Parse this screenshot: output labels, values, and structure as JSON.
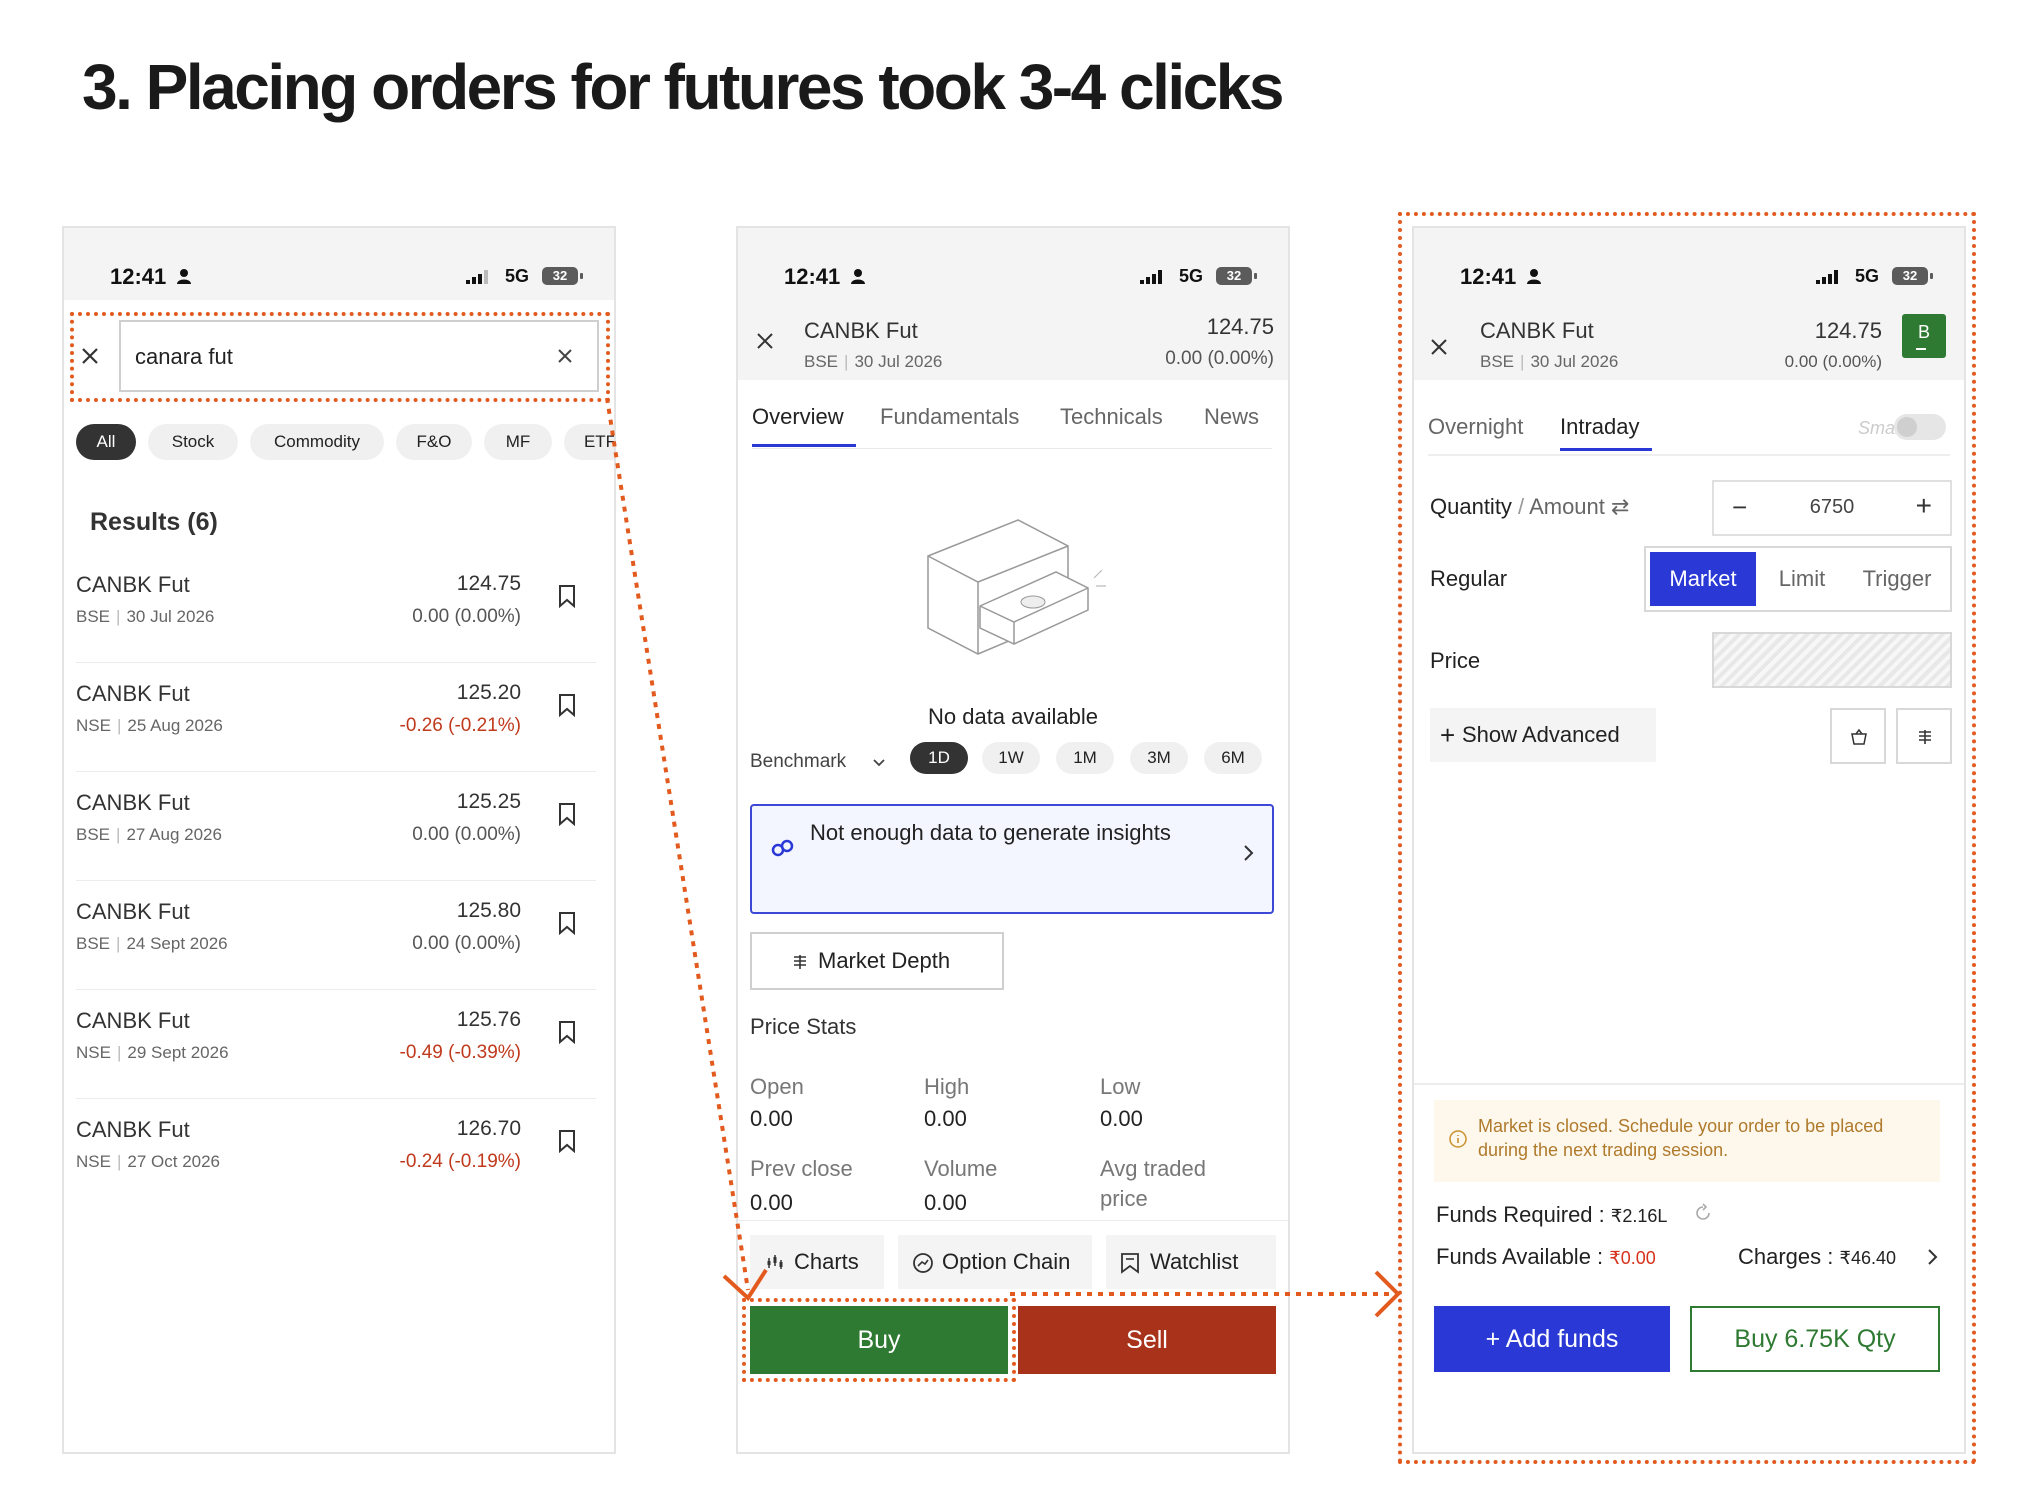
{
  "slide": {
    "title": "3.  Placing orders for futures took 3-4 clicks"
  },
  "status_bar": {
    "time": "12:41",
    "network": "5G",
    "battery": "32"
  },
  "search_screen": {
    "query": "canara fut",
    "filters": [
      "All",
      "Stock",
      "Commodity",
      "F&O",
      "MF",
      "ETF"
    ],
    "active_filter": "All",
    "results_heading": "Results (6)",
    "results": [
      {
        "name": "CANBK Fut",
        "exchange": "BSE",
        "expiry": "30 Jul 2026",
        "price": "124.75",
        "change": "0.00 (0.00%)",
        "negative": false
      },
      {
        "name": "CANBK Fut",
        "exchange": "NSE",
        "expiry": "25 Aug 2026",
        "price": "125.20",
        "change": "-0.26 (-0.21%)",
        "negative": true
      },
      {
        "name": "CANBK Fut",
        "exchange": "BSE",
        "expiry": "27 Aug 2026",
        "price": "125.25",
        "change": "0.00 (0.00%)",
        "negative": false
      },
      {
        "name": "CANBK Fut",
        "exchange": "BSE",
        "expiry": "24 Sept 2026",
        "price": "125.80",
        "change": "0.00 (0.00%)",
        "negative": false
      },
      {
        "name": "CANBK Fut",
        "exchange": "NSE",
        "expiry": "29 Sept 2026",
        "price": "125.76",
        "change": "-0.49 (-0.39%)",
        "negative": true
      },
      {
        "name": "CANBK Fut",
        "exchange": "NSE",
        "expiry": "27 Oct 2026",
        "price": "126.70",
        "change": "-0.24 (-0.19%)",
        "negative": true
      }
    ]
  },
  "detail_screen": {
    "name": "CANBK Fut",
    "exchange": "BSE",
    "expiry": "30 Jul 2026",
    "price": "124.75",
    "change": "0.00 (0.00%)",
    "tabs": [
      "Overview",
      "Fundamentals",
      "Technicals",
      "News"
    ],
    "active_tab": "Overview",
    "no_data": "No data available",
    "benchmark_label": "Benchmark",
    "ranges": [
      "1D",
      "1W",
      "1M",
      "3M",
      "6M"
    ],
    "active_range": "1D",
    "insight_text": "Not enough data to generate insights",
    "market_depth": "Market Depth",
    "price_stats_heading": "Price Stats",
    "stats": [
      {
        "label": "Open",
        "value": "0.00"
      },
      {
        "label": "High",
        "value": "0.00"
      },
      {
        "label": "Low",
        "value": "0.00"
      },
      {
        "label": "Prev close",
        "value": "0.00"
      },
      {
        "label": "Volume",
        "value": "0.00"
      },
      {
        "label": "Avg traded",
        "label2": "price"
      }
    ],
    "actions": [
      "Charts",
      "Option Chain",
      "Watchlist"
    ],
    "buy": "Buy",
    "sell": "Sell"
  },
  "order_screen": {
    "name": "CANBK Fut",
    "exchange": "BSE",
    "expiry": "30 Jul 2026",
    "price": "124.75",
    "change": "0.00 (0.00%)",
    "side_badge": "B",
    "product_tabs": [
      "Overnight",
      "Intraday"
    ],
    "active_product": "Intraday",
    "smart_label": "Smart",
    "quantity_label": "Quantity",
    "amount_label": "Amount",
    "quantity": "6750",
    "regular_label": "Regular",
    "order_types": [
      "Market",
      "Limit",
      "Trigger"
    ],
    "active_order_type": "Market",
    "price_label": "Price",
    "show_advanced": "Show Advanced",
    "market_closed": "Market is closed. Schedule your order to be placed during the next trading session.",
    "funds_required_label": "Funds Required : ",
    "funds_required": "₹2.16L",
    "funds_available_label": "Funds Available : ",
    "funds_available": "₹0.00",
    "charges_label": "Charges : ",
    "charges": "₹46.40",
    "add_funds": "+ Add funds",
    "buy_qty": "Buy 6.75K Qty"
  },
  "colors": {
    "accent_blue": "#2a39d6",
    "buy_green": "#2f7a32",
    "sell_red": "#a9321b",
    "annotation_orange": "#e35a1e",
    "negative_red": "#c0391b"
  }
}
